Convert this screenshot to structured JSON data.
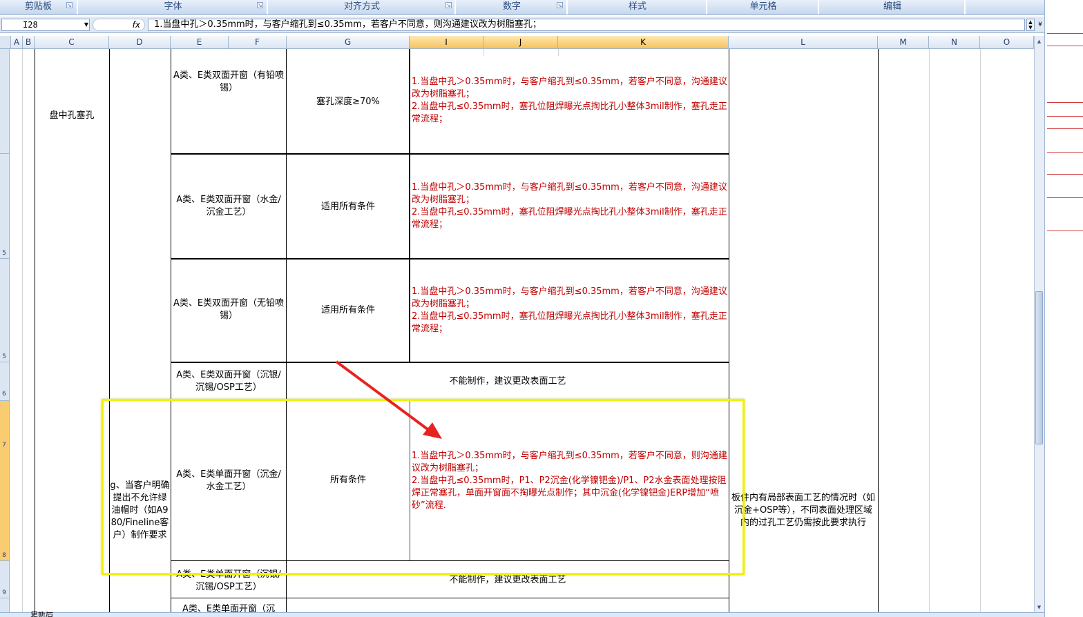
{
  "ribbon": {
    "groups": [
      "剪贴板",
      "字体",
      "对齐方式",
      "数字",
      "样式",
      "单元格",
      "编辑"
    ]
  },
  "formula_bar": {
    "name_box": "I28",
    "fx_label": "fx",
    "formula": "1.当盘中孔＞0.35mm时，与客户缩孔到≤0.35mm，若客户不同意，则沟通建议改为树脂塞孔；"
  },
  "columns": [
    "A",
    "B",
    "C",
    "D",
    "E",
    "F",
    "G",
    "I",
    "J",
    "K",
    "L",
    "M",
    "N",
    "O"
  ],
  "row_labels": [
    "5",
    "5",
    "6",
    "7",
    "8",
    "9"
  ],
  "cells": {
    "c_merged": "盘中孔塞孔",
    "row1_e": "A类、E类双面开窗（有铅喷锡）",
    "row1_g": "塞孔深度≥70%",
    "row1_i": "1.当盘中孔＞0.35mm时，与客户缩孔到≤0.35mm，若客户不同意，沟通建议改为树脂塞孔；\n2.当盘中孔≤0.35mm时，塞孔位阻焊曝光点掏比孔小整体3mil制作，塞孔走正常流程；",
    "row2_e": "A类、E类双面开窗（水金/沉金工艺）",
    "row2_g": "适用所有条件",
    "row2_i": "1.当盘中孔＞0.35mm时，与客户缩孔到≤0.35mm，若客户不同意，沟通建议改为树脂塞孔；\n2.当盘中孔≤0.35mm时，塞孔位阻焊曝光点掏比孔小整体3mil制作，塞孔走正常流程；",
    "row3_e": "A类、E类双面开窗（无铅喷锡）",
    "row3_g": "适用所有条件",
    "row3_i": "1.当盘中孔＞0.35mm时，与客户缩孔到≤0.35mm，若客户不同意，沟通建议改为树脂塞孔；\n2.当盘中孔≤0.35mm时，塞孔位阻焊曝光点掏比孔小整体3mil制作，塞孔走正常流程；",
    "row4_e": "A类、E类双面开窗（沉银/沉锡/OSP工艺）",
    "row4_gk": "不能制作，建议更改表面工艺",
    "d_merged": "g、当客户明确提出不允许绿油帽时（如A980/Fineline客户）制作要求",
    "row5_e": "A类、E类单面开窗（沉金/水金工艺）",
    "row5_g": "所有条件",
    "row5_i": "1.当盘中孔＞0.35mm时，与客户缩孔到≤0.35mm，若客户不同意，则沟通建议改为树脂塞孔；\n2.当盘中孔≤0.35mm时，P1、P2沉金(化学镍钯金)/P1、P2水金表面处理按阻焊正常塞孔，单面开窗面不掏曝光点制作；其中沉金(化学镍钯金)ERP增加“喷砂”流程.",
    "l_merged": "板件内有局部表面工艺的情况时（如沉金+OSP等），不同表面处理区域内的过孔工艺仍需按此要求执行",
    "row6_e": "A类、E类单面开窗（沉银/沉锡/OSP工艺）",
    "row6_gk": "不能制作，建议更改表面工艺",
    "row7_e": "A类、E类单面开窗（沉"
  },
  "sheet_tab": "更新后",
  "annotation": {
    "arrow_color": "#e8231f",
    "box_color": "#f2f200",
    "text_red": "#c00000",
    "selected_header": "#f8c25b"
  }
}
